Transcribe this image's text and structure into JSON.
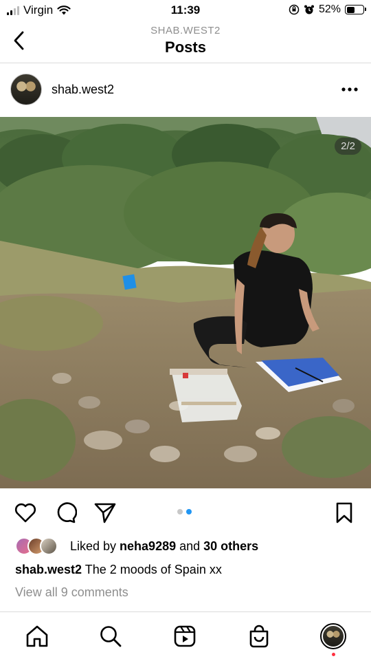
{
  "status_bar": {
    "carrier": "Virgin",
    "time": "11:39",
    "battery": "52%",
    "battery_level": 0.52,
    "icons": [
      "signal-icon",
      "wifi-icon",
      "orientation-lock-icon",
      "alarm-icon",
      "battery-icon"
    ]
  },
  "header": {
    "subtitle": "SHAB.WEST2",
    "title": "Posts",
    "back_icon": "chevron-left-icon"
  },
  "post": {
    "username": "shab.west2",
    "more_icon": "more-horizontal-icon",
    "photo_counter": "2/2",
    "carousel_dots": 2,
    "carousel_active": 2,
    "likes": {
      "prefix": "Liked by ",
      "user": "neha9289",
      "middle": " and ",
      "others": "30 others"
    },
    "caption": {
      "user": "shab.west2",
      "text": " The 2 moods of Spain xx"
    },
    "view_comments": "View all 9 comments",
    "accent_color": "#2196f3"
  },
  "bottom_nav": {
    "items": [
      "home-icon",
      "search-icon",
      "reels-icon",
      "shop-icon",
      "profile-avatar"
    ]
  }
}
